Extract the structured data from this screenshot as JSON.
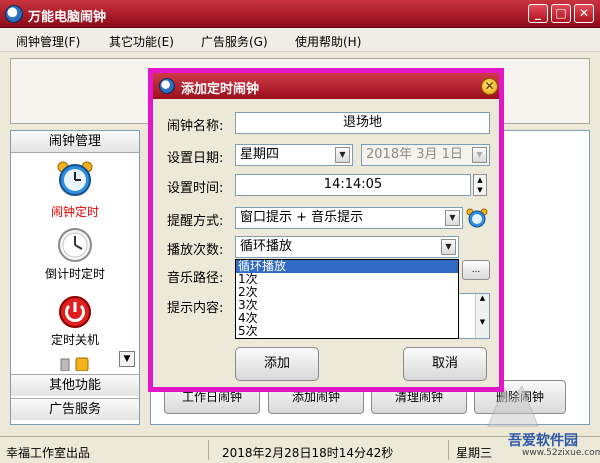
{
  "window": {
    "title": "万能电脑闹钟",
    "min_glyph": "_",
    "max_glyph": "□",
    "close_glyph": "✕"
  },
  "menu": [
    "闹钟管理(F)",
    "其它功能(E)",
    "广告服务(G)",
    "使用帮助(H)"
  ],
  "left_panel": {
    "header": "闹钟管理",
    "items": [
      {
        "label": "闹钟定时",
        "icon": "alarm-clock-icon",
        "active": true
      },
      {
        "label": "倒计时定时",
        "icon": "clock-icon",
        "active": false
      },
      {
        "label": "定时关机",
        "icon": "power-icon",
        "active": false
      }
    ],
    "scroll_glyph": "▼",
    "footer_items": [
      "其他功能",
      "广告服务"
    ]
  },
  "right_panel": {
    "buttons": [
      "工作日闹钟",
      "添加闹钟",
      "清理闹钟",
      "删除闹钟"
    ]
  },
  "status": {
    "left": "幸福工作室出品",
    "datetime": "2018年2月28日18时14分42秒",
    "weekday": "星期三"
  },
  "watermark": {
    "brand": "吾爱软件园",
    "url": "www.52zixue.com"
  },
  "dialog": {
    "title": "添加定时闹钟",
    "close_glyph": "✕",
    "fields": {
      "name_label": "闹钟名称:",
      "name_value": "退场地",
      "date_label": "设置日期:",
      "date_weekday": "星期四",
      "date_value": "2018年 3月 1日",
      "time_label": "设置时间:",
      "time_value": "14:14:05",
      "remind_label": "提醒方式:",
      "remind_value": "窗口提示 + 音乐提示",
      "play_label": "播放次数:",
      "play_value": "循环播放",
      "music_label": "音乐路径:",
      "content_label": "提示内容:"
    },
    "dropdown_options": [
      "循环播放",
      "1次",
      "2次",
      "3次",
      "4次",
      "5次"
    ],
    "dropdown_selected": "循环播放",
    "add_button": "添加",
    "cancel_button": "取消",
    "browse_glyph": "..."
  },
  "colors": {
    "titlebar": "#b0202c",
    "dialog_border": "#e316c8",
    "selection": "#316ac5",
    "active_item_text": "#e00000"
  }
}
